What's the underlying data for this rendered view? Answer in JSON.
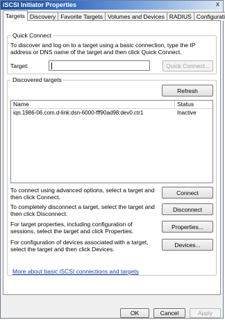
{
  "window": {
    "title": "iSCSI Initiator Properties",
    "close_glyph": "x"
  },
  "tabs": [
    {
      "label": "Targets",
      "active": true
    },
    {
      "label": "Discovery"
    },
    {
      "label": "Favorite Targets"
    },
    {
      "label": "Volumes and Devices"
    },
    {
      "label": "RADIUS"
    },
    {
      "label": "Configuration"
    }
  ],
  "quick_connect": {
    "title": "Quick Connect",
    "description": "To discover and log on to a target using a basic connection, type the IP address or DNS name of the target and then click Quick Connect.",
    "target_label": "Target:",
    "target_value": "",
    "button": "Quick Connect..."
  },
  "discovered": {
    "title": "Discovered targets",
    "refresh_button": "Refresh",
    "columns": {
      "name": "Name",
      "status": "Status"
    },
    "rows": [
      {
        "name": "iqn.1986-06.com.d-link:dsn-6000-fff90ad98:dev0.ctr1",
        "status": "Inactive"
      }
    ]
  },
  "actions": {
    "connect": {
      "text": "To connect using advanced options, select a target and then click Connect.",
      "button": "Connect"
    },
    "disconnect": {
      "text": "To completely disconnect a target, select the target and then click Disconnect.",
      "button": "Disconnect"
    },
    "properties": {
      "text": "For target properties, including configuration of sessions, select the target and click Properties.",
      "button": "Properties..."
    },
    "devices": {
      "text": "For configuration of devices associated with a target, select the target and then click Devices.",
      "button": "Devices..."
    }
  },
  "link": "More about basic iSCSI connections and targets",
  "footer": {
    "ok": "OK",
    "cancel": "Cancel",
    "apply": "Apply"
  }
}
